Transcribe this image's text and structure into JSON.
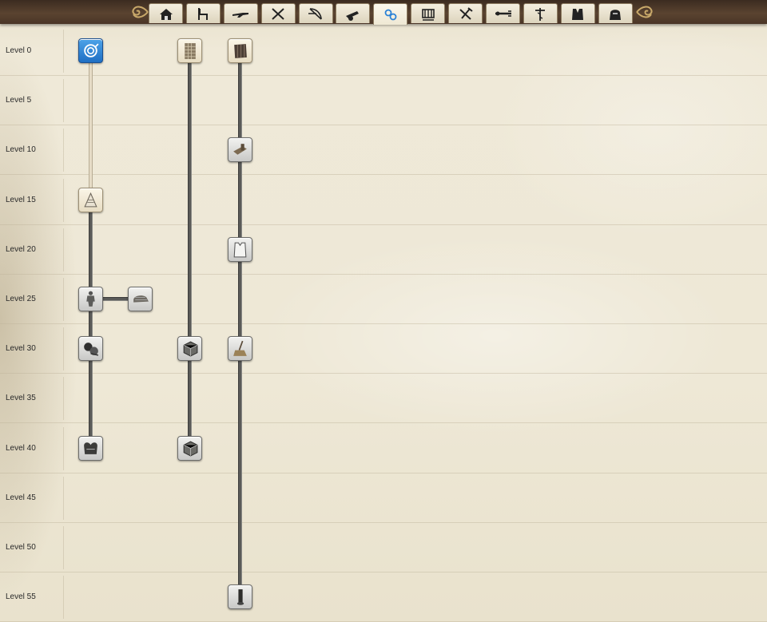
{
  "tabs": [
    {
      "icon": "house-icon"
    },
    {
      "icon": "chair-icon"
    },
    {
      "icon": "rifle-icon"
    },
    {
      "icon": "crossed-swords-icon"
    },
    {
      "icon": "bow-icon"
    },
    {
      "icon": "cannon-icon"
    },
    {
      "icon": "chain-links-icon",
      "active": true
    },
    {
      "icon": "loom-icon"
    },
    {
      "icon": "tools-icon"
    },
    {
      "icon": "utensils-icon"
    },
    {
      "icon": "caduceus-icon"
    },
    {
      "icon": "vest-icon"
    },
    {
      "icon": "bag-icon"
    }
  ],
  "levels": [
    "Level 0",
    "Level 5",
    "Level 10",
    "Level 15",
    "Level 20",
    "Level 25",
    "Level 30",
    "Level 35",
    "Level 40",
    "Level 45",
    "Level 50",
    "Level 55"
  ],
  "nodes": [
    {
      "id": "rope-coil",
      "icon": "rope-coil-icon",
      "column": 1,
      "level": 0,
      "state": "selected"
    },
    {
      "id": "net",
      "icon": "net-icon",
      "column": 2,
      "level": 0,
      "state": "cream"
    },
    {
      "id": "fabric-roll",
      "icon": "fabric-roll-icon",
      "column": 3,
      "level": 0,
      "state": "cream"
    },
    {
      "id": "cone-hat",
      "icon": "cone-hat-icon",
      "column": 1,
      "level": 15,
      "state": "cream"
    },
    {
      "id": "plank-tool",
      "icon": "plank-tool-icon",
      "column": 3,
      "level": 10,
      "state": "gray"
    },
    {
      "id": "shirt",
      "icon": "shirt-icon",
      "column": 3,
      "level": 20,
      "state": "gray"
    },
    {
      "id": "suit",
      "icon": "suit-icon",
      "column": 1,
      "level": 25,
      "state": "gray"
    },
    {
      "id": "cap",
      "icon": "cap-icon",
      "column": 2,
      "level": 25,
      "state": "gray"
    },
    {
      "id": "yarn-balls",
      "icon": "yarn-balls-icon",
      "column": 1,
      "level": 30,
      "state": "gray"
    },
    {
      "id": "mesh-cube",
      "icon": "mesh-cube-icon",
      "column": 2,
      "level": 30,
      "state": "gray"
    },
    {
      "id": "broom",
      "icon": "broom-icon",
      "column": 3,
      "level": 30,
      "state": "gray"
    },
    {
      "id": "basket",
      "icon": "basket-icon",
      "column": 1,
      "level": 40,
      "state": "gray"
    },
    {
      "id": "mesh-cube-large",
      "icon": "mesh-cube-icon",
      "column": 2,
      "level": 40,
      "state": "gray"
    },
    {
      "id": "rolled-cloth",
      "icon": "rolled-cloth-icon",
      "column": 3,
      "level": 55,
      "state": "gray"
    }
  ],
  "connections": [
    {
      "from": "rope-coil",
      "to": "cone-hat",
      "style": "light"
    },
    {
      "from": "cone-hat",
      "to": "basket",
      "style": "dark"
    },
    {
      "from": "suit",
      "to": "cap",
      "style": "dark"
    },
    {
      "from": "net",
      "to": "mesh-cube-large",
      "style": "dark"
    },
    {
      "from": "fabric-roll",
      "to": "rolled-cloth",
      "style": "dark"
    }
  ],
  "colors": {
    "selected": "#2b82d6",
    "parchment": "#efe9d8",
    "line": "#5a5a58",
    "leather": "#4a3526"
  }
}
